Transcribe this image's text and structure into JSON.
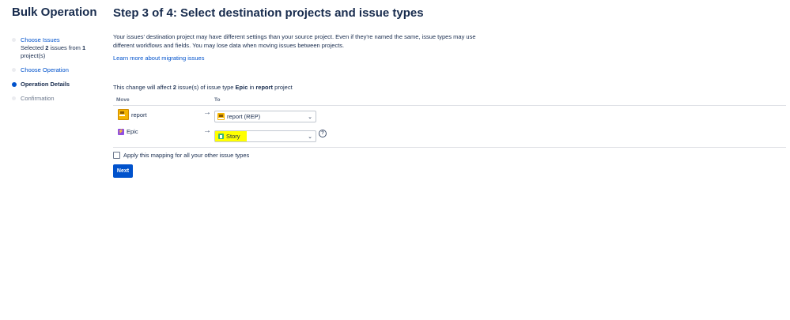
{
  "sidebar": {
    "title": "Bulk Operation",
    "steps": [
      {
        "label": "Choose Issues",
        "sub_prefix": "Selected ",
        "sub_count": "2",
        "sub_mid": " issues from ",
        "sub_projects": "1",
        "sub_suffix": "project(s)"
      },
      {
        "label": "Choose Operation"
      },
      {
        "label": "Operation Details"
      },
      {
        "label": "Confirmation"
      }
    ]
  },
  "main": {
    "title": "Step 3 of 4: Select destination projects and issue types",
    "intro": "Your issues' destination project may have different settings than your source project. Even if they're named the same, issue types may use different workflows and fields. You may lose data when moving issues between projects.",
    "learn_more": "Learn more about migrating issues",
    "affect_prefix": "This change will affect ",
    "affect_count": "2",
    "affect_mid": " issue(s) of issue type ",
    "affect_type": "Epic",
    "affect_in": " in ",
    "affect_project": "report",
    "affect_suffix": " project",
    "table": {
      "col_move": "Move",
      "col_to": "To",
      "rows": [
        {
          "from": "report",
          "from_icon": "project-icon",
          "to": "report (REP)",
          "to_icon": "project-icon"
        },
        {
          "from": "Epic",
          "from_icon": "epic-icon",
          "to": "Story",
          "to_icon": "story-icon"
        }
      ]
    },
    "apply_label": "Apply this mapping for all your other issue types",
    "next_label": "Next"
  },
  "icons": {
    "arrow": "→",
    "caret": "⌄",
    "help": "?"
  },
  "colors": {
    "primary": "#0052cc",
    "text": "#172b4d",
    "highlight": "#ffff00",
    "epic": "#904ee2",
    "story": "#36b37e",
    "project": "#f4b400"
  }
}
